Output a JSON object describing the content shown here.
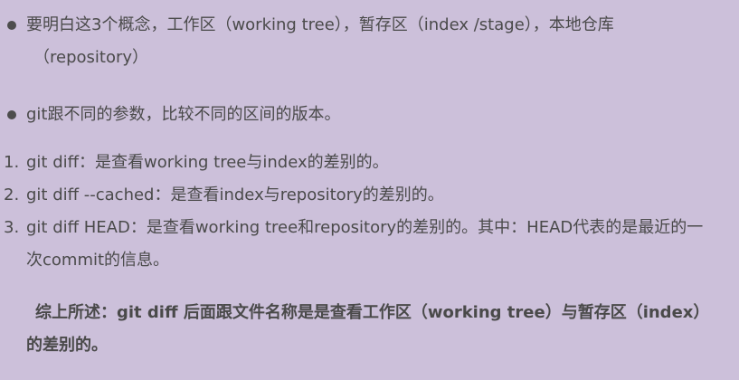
{
  "bullets": [
    {
      "line1": "要明白这3个概念，工作区（working tree），暂存区（index /stage），本地仓库",
      "line2": "（repository）"
    },
    {
      "line1": "git跟不同的参数，比较不同的区间的版本。"
    }
  ],
  "numbered": [
    {
      "num": "1.",
      "text": "git diff：是查看working tree与index的差别的。"
    },
    {
      "num": "2.",
      "text": "git diff --cached：是查看index与repository的差别的。"
    },
    {
      "num": "3.",
      "text": "git diff HEAD：是查看working tree和repository的差别的。其中：HEAD代表的是最近的一",
      "text2": "次commit的信息。"
    }
  ],
  "summary": {
    "line1": "综上所述：git diff 后面跟文件名称是是查看工作区（working tree）与暂存区（index）",
    "line2": "的差别的。"
  }
}
